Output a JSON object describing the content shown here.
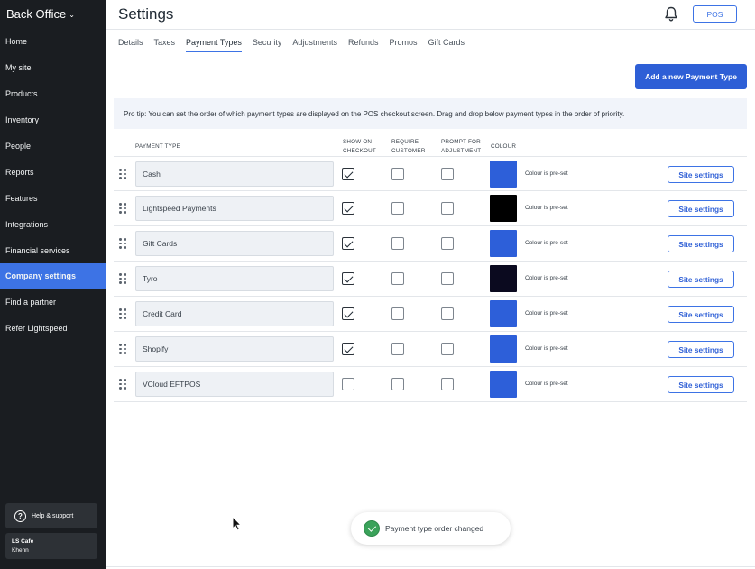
{
  "app": {
    "brand": "Back Office",
    "page_title": "Settings",
    "pos_label": "POS"
  },
  "sidebar": {
    "items": [
      {
        "label": "Home",
        "active": false
      },
      {
        "label": "My site",
        "active": false
      },
      {
        "label": "Products",
        "active": false
      },
      {
        "label": "Inventory",
        "active": false
      },
      {
        "label": "People",
        "active": false
      },
      {
        "label": "Reports",
        "active": false
      },
      {
        "label": "Features",
        "active": false
      },
      {
        "label": "Integrations",
        "active": false
      },
      {
        "label": "Financial services",
        "active": false
      },
      {
        "label": "Company settings",
        "active": true
      },
      {
        "label": "Find a partner",
        "active": false
      },
      {
        "label": "Refer Lightspeed",
        "active": false
      }
    ],
    "help_label": "Help & support",
    "account_name": "LS Cafe",
    "account_user": "Khenn"
  },
  "tabs": [
    {
      "label": "Details",
      "active": false
    },
    {
      "label": "Taxes",
      "active": false
    },
    {
      "label": "Payment Types",
      "active": true
    },
    {
      "label": "Security",
      "active": false
    },
    {
      "label": "Adjustments",
      "active": false
    },
    {
      "label": "Refunds",
      "active": false
    },
    {
      "label": "Promos",
      "active": false
    },
    {
      "label": "Gift Cards",
      "active": false
    }
  ],
  "add_button_label": "Add a new Payment Type",
  "pro_tip": "Pro tip: You can set the order of which payment types are displayed on the POS checkout screen. Drag and drop below payment types in the order of priority.",
  "table": {
    "headers": {
      "payment_type": "PAYMENT TYPE",
      "show_on_checkout_1": "SHOW ON",
      "show_on_checkout_2": "CHECKOUT",
      "require_customer_1": "REQUIRE",
      "require_customer_2": "CUSTOMER",
      "prompt_adjustment_1": "PROMPT FOR",
      "prompt_adjustment_2": "ADJUSTMENT",
      "colour": "COLOUR"
    },
    "rows": [
      {
        "name": "Cash",
        "show_on_checkout": true,
        "require_customer": false,
        "prompt_adjustment": false,
        "colour": "#2d5fd9",
        "colour_note": "Colour is pre-set",
        "action": "Site settings"
      },
      {
        "name": "Lightspeed Payments",
        "show_on_checkout": true,
        "require_customer": false,
        "prompt_adjustment": false,
        "colour": "#000000",
        "colour_note": "Colour is pre-set",
        "action": "Site settings"
      },
      {
        "name": "Gift Cards",
        "show_on_checkout": true,
        "require_customer": false,
        "prompt_adjustment": false,
        "colour": "#2d5fd9",
        "colour_note": "Colour is pre-set",
        "action": "Site settings"
      },
      {
        "name": "Tyro",
        "show_on_checkout": true,
        "require_customer": false,
        "prompt_adjustment": false,
        "colour": "#0b0a1f",
        "colour_note": "Colour is pre-set",
        "action": "Site settings"
      },
      {
        "name": "Credit Card",
        "show_on_checkout": true,
        "require_customer": false,
        "prompt_adjustment": false,
        "colour": "#2d5fd9",
        "colour_note": "Colour is pre-set",
        "action": "Site settings"
      },
      {
        "name": "Shopify",
        "show_on_checkout": true,
        "require_customer": false,
        "prompt_adjustment": false,
        "colour": "#2d5fd9",
        "colour_note": "Colour is pre-set",
        "action": "Site settings"
      },
      {
        "name": "VCloud EFTPOS",
        "show_on_checkout": false,
        "require_customer": false,
        "prompt_adjustment": false,
        "colour": "#2d5fd9",
        "colour_note": "Colour is pre-set",
        "action": "Site settings"
      }
    ]
  },
  "toast": {
    "message": "Payment type order changed",
    "icon": "check-circle-icon",
    "color": "#3aa25a"
  },
  "colors": {
    "accent": "#3d73e5",
    "sidebar_bg": "#1a1d21"
  }
}
